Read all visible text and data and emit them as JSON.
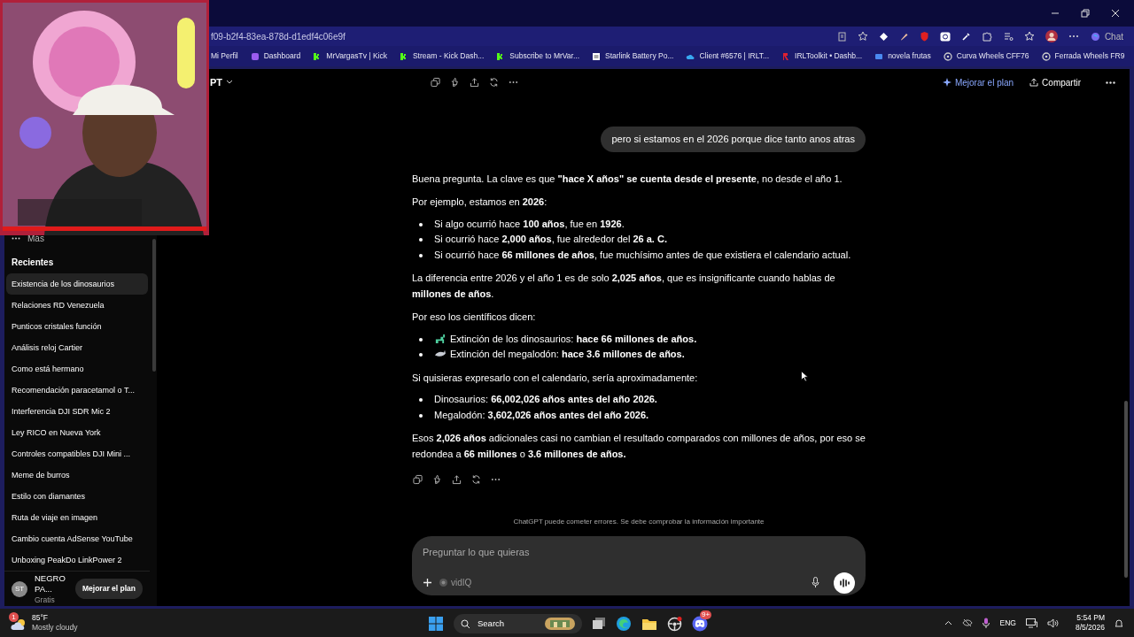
{
  "browser": {
    "address": "f09-b2f4-83ea-878d-d1edf4c06e9f",
    "chat_label": "Chat",
    "bookmarks": [
      {
        "label": "Mi Perfil",
        "kind": "plain"
      },
      {
        "label": "Dashboard",
        "kind": "purple"
      },
      {
        "label": "MrVargasTv | Kick",
        "kind": "kick"
      },
      {
        "label": "Stream - Kick Dash...",
        "kind": "kick"
      },
      {
        "label": "Subscribe to MrVar...",
        "kind": "kick"
      },
      {
        "label": "Starlink Battery Po...",
        "kind": "page"
      },
      {
        "label": "Client #6576 | IRLT...",
        "kind": "cloud"
      },
      {
        "label": "IRLToolkit • Dashb...",
        "kind": "red"
      },
      {
        "label": "novela frutas",
        "kind": "blue"
      },
      {
        "label": "Curva Wheels CFF76",
        "kind": "wheel"
      },
      {
        "label": "Ferrada Wheels FR9",
        "kind": "wheel"
      }
    ]
  },
  "header": {
    "model": "PT",
    "upgrade": "Mejorar el plan",
    "share": "Compartir"
  },
  "sidebar": {
    "more": "Más",
    "section": "Recientes",
    "items": [
      {
        "label": "Existencia de los dinosaurios",
        "selected": true
      },
      {
        "label": "Relaciones RD Venezuela",
        "selected": false
      },
      {
        "label": "Punticos cristales función",
        "selected": false
      },
      {
        "label": "Análisis reloj Cartier",
        "selected": false
      },
      {
        "label": "Como está hermano",
        "selected": false
      },
      {
        "label": "Recomendación paracetamol o T...",
        "selected": false
      },
      {
        "label": "Interferencia DJI SDR Mic 2",
        "selected": false
      },
      {
        "label": "Ley RICO en Nueva York",
        "selected": false
      },
      {
        "label": "Controles compatibles DJI Mini ...",
        "selected": false
      },
      {
        "label": "Meme de burros",
        "selected": false
      },
      {
        "label": "Estilo con diamantes",
        "selected": false
      },
      {
        "label": "Ruta de viaje en imagen",
        "selected": false
      },
      {
        "label": "Cambio cuenta AdSense YouTube",
        "selected": false
      },
      {
        "label": "Unboxing PeakDo LinkPower 2",
        "selected": false
      }
    ],
    "user": {
      "initials": "ST",
      "name": "NEGRO PA...",
      "plan": "Gratis"
    },
    "upgrade": "Mejorar el plan"
  },
  "conversation": {
    "user_message": "pero si estamos en el 2026 porque dice tanto anos atras",
    "answer": [
      {
        "kind": "paragraph",
        "text": "Buena pregunta. La clave es que **\"hace X años\" se cuenta desde el presente**, no desde el año 1."
      },
      {
        "kind": "paragraph",
        "text": "Por ejemplo, estamos en **2026**:"
      },
      {
        "kind": "list",
        "items": [
          {
            "kind": "plain",
            "text": "Si algo ocurrió hace **100 años**, fue en **1926**."
          },
          {
            "kind": "plain",
            "text": "Si ocurrió hace **2,000 años**, fue alrededor del **26 a. C.**"
          },
          {
            "kind": "plain",
            "text": "Si ocurrió hace **66 millones de años**, fue muchísimo antes de que existiera el calendario actual."
          }
        ]
      },
      {
        "kind": "paragraph",
        "text": "La diferencia entre 2026 y el año 1 es de solo **2,025 años**, que es insignificante cuando hablas de **millones de años**."
      },
      {
        "kind": "paragraph",
        "text": "Por eso los científicos dicen:"
      },
      {
        "kind": "list",
        "items": [
          {
            "kind": "dinosaur",
            "text": "Extinción de los dinosaurios: **hace 66 millones de años.**"
          },
          {
            "kind": "shark",
            "text": "Extinción del megalodón: **hace 3.6 millones de años.**"
          }
        ]
      },
      {
        "kind": "paragraph",
        "text": "Si quisieras expresarlo con el calendario, sería aproximadamente:"
      },
      {
        "kind": "list",
        "items": [
          {
            "kind": "plain",
            "text": "Dinosaurios: **66,002,026 años antes del año 2026.**"
          },
          {
            "kind": "plain",
            "text": "Megalodón: **3,602,026 años antes del año 2026.**"
          }
        ]
      },
      {
        "kind": "paragraph",
        "text": "Esos **2,026 años** adicionales casi no cambian el resultado comparados con millones de años, por eso se redondea a **66 millones** o **3.6 millones de años.**"
      }
    ]
  },
  "disclaimer": "ChatGPT puede cometer errores. Se debe comprobar la información importante",
  "composer": {
    "placeholder": "Preguntar lo que quieras",
    "tool": "vidIQ"
  },
  "taskbar": {
    "weather_badge": "1",
    "temperature": "85°F",
    "condition": "Mostly cloudy",
    "search": "Search",
    "chat_badge": "9+",
    "language": "ENG",
    "time": "5:54 PM",
    "date": "8/5/2026"
  }
}
